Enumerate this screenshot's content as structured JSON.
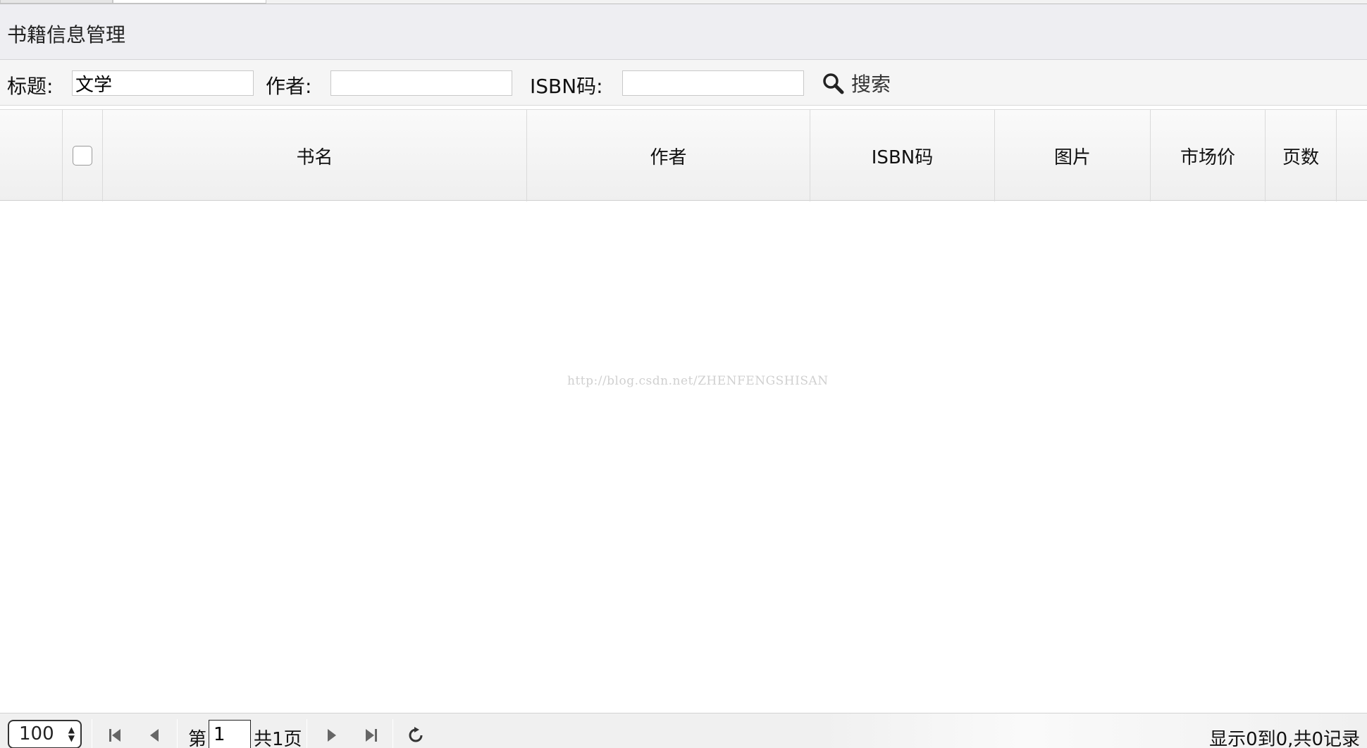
{
  "panel": {
    "title": "书籍信息管理"
  },
  "search": {
    "title_label": "标题:",
    "title_value": "文学",
    "author_label": "作者:",
    "author_value": "",
    "isbn_label": "ISBN码:",
    "isbn_value": "",
    "button_label": "搜索",
    "button_icon": "search-icon"
  },
  "grid": {
    "columns": [
      "书名",
      "作者",
      "ISBN码",
      "图片",
      "市场价",
      "页数"
    ],
    "rows": []
  },
  "watermark": "http://blog.csdn.net/ZHENFENGSHISAN",
  "pager": {
    "page_size": "100",
    "page_prefix": "第",
    "current_page": "1",
    "total_pages": "共1页",
    "summary": "显示0到0,共0记录"
  }
}
